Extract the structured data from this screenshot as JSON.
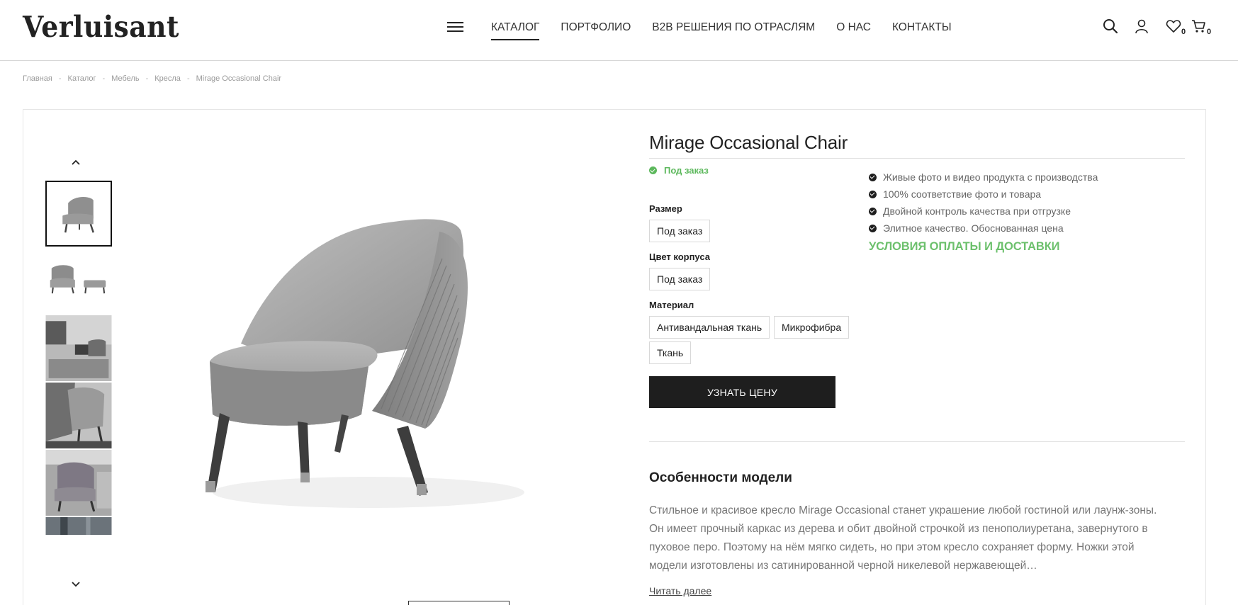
{
  "header": {
    "logo": "Verluisant",
    "nav": [
      "КАТАЛОГ",
      "ПОРТФОЛИО",
      "B2B РЕШЕНИЯ ПО ОТРАСЛЯМ",
      "О НАС",
      "КОНТАКТЫ"
    ],
    "active_nav_index": 0,
    "icons": [
      "menu-icon",
      "search-icon",
      "user-icon",
      "heart-icon",
      "cart-icon"
    ],
    "wishlist_count": "0",
    "cart_count": "0"
  },
  "breadcrumb": [
    "Главная",
    "Каталог",
    "Мебель",
    "Кресла",
    "Mirage Occasional Chair"
  ],
  "product": {
    "title": "Mirage Occasional Chair",
    "status": "Под заказ",
    "options": {
      "size": {
        "label": "Размер",
        "values": [
          "Под заказ"
        ]
      },
      "body_color": {
        "label": "Цвет корпуса",
        "values": [
          "Под заказ"
        ]
      },
      "material": {
        "label": "Материал",
        "values": [
          "Антивандальная ткань",
          "Микрофибра",
          "Ткань"
        ]
      }
    },
    "cta_label": "УЗНАТЬ ЦЕНУ",
    "benefits": [
      "Живые фото и видео продукта с производства",
      "100% соответствие фото и товара",
      "Двойной контроль качества при отгрузке",
      "Элитное качество. Обоснованная цена"
    ],
    "terms_link": "УСЛОВИЯ ОПЛАТЫ И ДОСТАВКИ",
    "features_title": "Особенности модели",
    "features_text": "Стильное и красивое кресло Mirage Occasional станет украшение любой гостиной или лаунж-зоны. Он имеет прочный каркас из дерева и обит двойной строчкой из пенополиуретана, завернутого в пуховое перо. Поэтому на нём мягко сидеть, но при этом кресло сохраняет форму. Ножки этой модели изготовлены из сатинированной черной никелевой нержавеющей…",
    "read_more": "Читать далее"
  },
  "colors": {
    "accent_green": "#5cb85c",
    "cta_bg": "#1e1e1e"
  }
}
